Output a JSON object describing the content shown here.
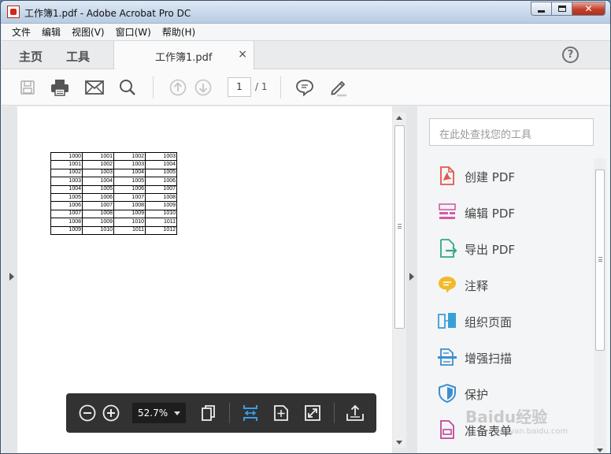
{
  "window": {
    "title": "工作簿1.pdf - Adobe Acrobat Pro DC"
  },
  "menu": [
    "文件",
    "编辑",
    "视图(V)",
    "窗口(W)",
    "帮助(H)"
  ],
  "tabs": {
    "home": "主页",
    "tools": "工具",
    "document": "工作簿1.pdf",
    "close": "×",
    "help": "?"
  },
  "toolbar": {
    "page_current": "1",
    "page_total": "/ 1"
  },
  "document": {
    "rows": [
      [
        "1000",
        "1001",
        "1002",
        "1003"
      ],
      [
        "1001",
        "1002",
        "1003",
        "1004"
      ],
      [
        "1002",
        "1003",
        "1004",
        "1005"
      ],
      [
        "1003",
        "1004",
        "1005",
        "1006"
      ],
      [
        "1004",
        "1005",
        "1006",
        "1007"
      ],
      [
        "1005",
        "1006",
        "1007",
        "1008"
      ],
      [
        "1006",
        "1007",
        "1008",
        "1009"
      ],
      [
        "1007",
        "1008",
        "1009",
        "1010"
      ],
      [
        "1008",
        "1009",
        "1010",
        "1011"
      ],
      [
        "1009",
        "1010",
        "1011",
        "1012"
      ]
    ]
  },
  "floating_toolbar": {
    "zoom": "52.7%"
  },
  "tools_pane": {
    "search_placeholder": "在此处查找您的工具",
    "items": [
      {
        "label": "创建 PDF",
        "icon": "create-pdf-icon",
        "color": "#e2574c"
      },
      {
        "label": "编辑 PDF",
        "icon": "edit-pdf-icon",
        "color": "#d65aa6"
      },
      {
        "label": "导出 PDF",
        "icon": "export-pdf-icon",
        "color": "#2fa887"
      },
      {
        "label": "注释",
        "icon": "comment-icon",
        "color": "#f2b929"
      },
      {
        "label": "组织页面",
        "icon": "organize-pages-icon",
        "color": "#39a0d6"
      },
      {
        "label": "增强扫描",
        "icon": "enhance-scan-icon",
        "color": "#3b8fd0"
      },
      {
        "label": "保护",
        "icon": "protect-icon",
        "color": "#3b8fd0"
      },
      {
        "label": "准备表单",
        "icon": "prepare-form-icon",
        "color": "#c0479a"
      }
    ]
  },
  "watermark": {
    "text": "Baidu经验",
    "sub": "jingyan.baidu.com"
  }
}
